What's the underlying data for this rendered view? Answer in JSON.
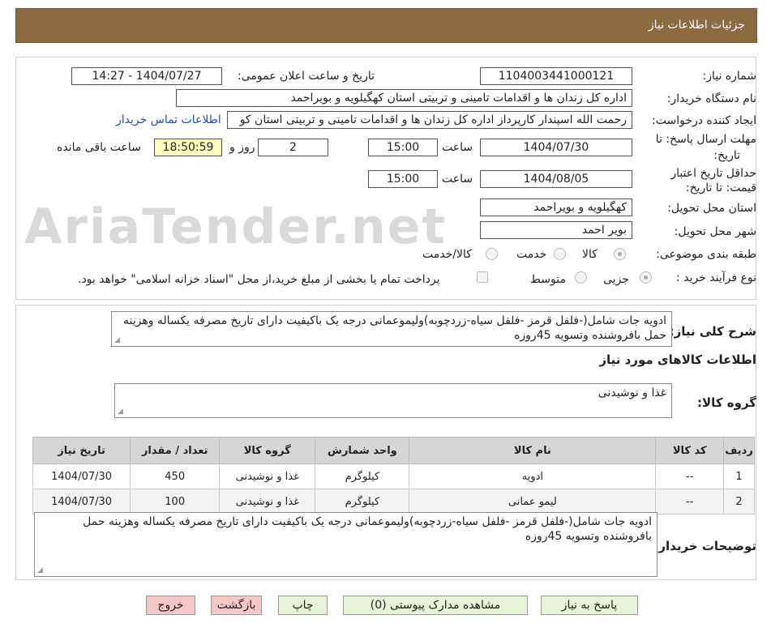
{
  "header": {
    "title": "جزئیات اطلاعات نیاز"
  },
  "watermark": "AriaTender.net",
  "form": {
    "need_number_label": "شماره نیاز:",
    "need_number": "1104003441000121",
    "announce_label": "تاریخ و ساعت اعلان عمومی:",
    "announce_value": "1404/07/27 - 14:27",
    "buyer_org_label": "نام دستگاه خریدار:",
    "buyer_org": "اداره کل زندان ها و اقدامات تامینی و تربیتی استان کهگیلویه و بویراحمد",
    "creator_label": "ایجاد کننده درخواست:",
    "creator": "رحمت الله اسپندار کارپرداز اداره کل زندان ها و اقدامات تامینی و تربیتی استان کو",
    "contact_link": "اطلاعات تماس خریدار",
    "deadline_label_1": "مهلت ارسال پاسخ: تا",
    "deadline_label_2": "تاریخ:",
    "deadline_date": "1404/07/30",
    "time_label": "ساعت",
    "deadline_time": "15:00",
    "days_value": "2",
    "days_label": "روز و",
    "remaining_time": "18:50:59",
    "remaining_label": "ساعت باقی مانده",
    "validity_label_1": "حداقل تاریخ اعتبار",
    "validity_label_2": "قیمت: تا تاریخ:",
    "validity_date": "1404/08/05",
    "validity_time_label": "ساعت",
    "validity_time": "15:00",
    "province_label": "استان محل تحویل:",
    "province": "کهگیلویه و بویراحمد",
    "city_label": "شهر محل تحویل:",
    "city": "بویر احمد",
    "category_label": "طبقه بندی موضوعی:",
    "category_options": [
      "کالا",
      "خدمت",
      "کالا/خدمت"
    ],
    "category_selected": "کالا",
    "process_label": "نوع فرآیند خرید :",
    "process_options": [
      "جزیی",
      "متوسط"
    ],
    "process_selected": "جزیی",
    "treasury_note": "پرداخت تمام یا بخشی از مبلغ خرید،از محل \"اسناد خزانه اسلامی\" خواهد بود."
  },
  "description": {
    "label": "شرح کلی نیاز:",
    "text": "ادویه جات شامل(-فلفل قرمز -فلفل سیاه-زردچوبه)ولیموعمانی درجه یک باکیفیت دارای تاریخ مصرفه یکساله وهزینه حمل بافروشنده وتسویه 45روزه"
  },
  "goods": {
    "title": "اطلاعات کالاهای مورد نیاز",
    "group_label": "گروه کالا:",
    "group_value": "غذا و نوشیدنی",
    "columns": [
      "ردیف",
      "کد کالا",
      "نام کالا",
      "واحد شمارش",
      "گروه کالا",
      "تعداد / مقدار",
      "تاریخ نیاز"
    ],
    "rows": [
      [
        "1",
        "--",
        "ادویه",
        "کیلوگرم",
        "غذا و نوشیدنی",
        "450",
        "1404/07/30"
      ],
      [
        "2",
        "--",
        "لیمو عمانی",
        "کیلوگرم",
        "غذا و نوشیدنی",
        "100",
        "1404/07/30"
      ]
    ]
  },
  "buyer_notes": {
    "label": "توضیحات خریدار:",
    "text": "ادویه جات شامل(-فلفل قرمز -فلفل سیاه-زردچوبه)ولیموعمانی درجه یک باکیفیت دارای تاریخ مصرفه یکساله وهزینه حمل بافروشنده وتسویه 45روزه"
  },
  "buttons": {
    "reply": "پاسخ به نیاز",
    "attachments": "مشاهده مدارک پیوستی (0)",
    "print": "چاپ",
    "back": "بازگشت",
    "exit": "خروج"
  },
  "colors": {
    "header_bg": "#8b6b3f",
    "button_bg": "#e6f3d6",
    "button_red": "#f7c7c7",
    "timer_bg": "#ffffc0",
    "link": "#1a4fd0"
  }
}
